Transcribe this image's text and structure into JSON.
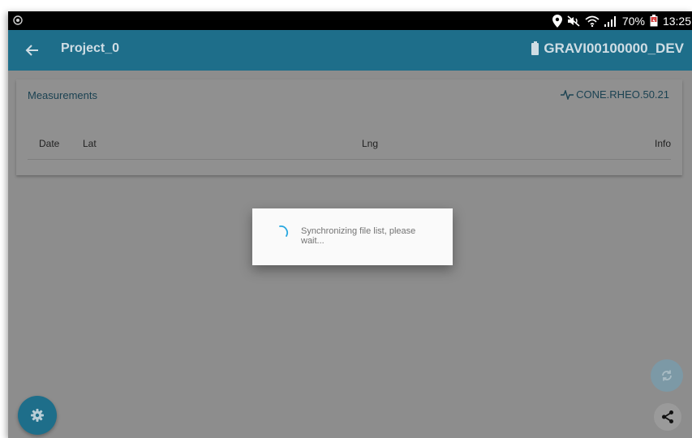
{
  "status_bar": {
    "battery": "70%",
    "time": "13:25",
    "icons": [
      "notification-icon",
      "location-icon",
      "mute-icon",
      "wifi-icon",
      "signal-icon",
      "battery-icon"
    ]
  },
  "app_bar": {
    "title": "Project_0",
    "device_id": "GRAVI00100000_DEV"
  },
  "card": {
    "title": "Measurements",
    "sensor": "CONE.RHEO.50.21",
    "columns": [
      "Date",
      "Lat",
      "Lng",
      "Info"
    ]
  },
  "dialog": {
    "message": "Synchronizing file list, please wait..."
  },
  "fabs": {
    "settings": "gear-icon",
    "sync": "sync-icon",
    "share": "share-icon"
  },
  "colors": {
    "app_bar": "#1e6e8a",
    "dimmed_background": "#8d8d8d",
    "accent": "#29a8e0",
    "dialog": "#fafafa"
  }
}
